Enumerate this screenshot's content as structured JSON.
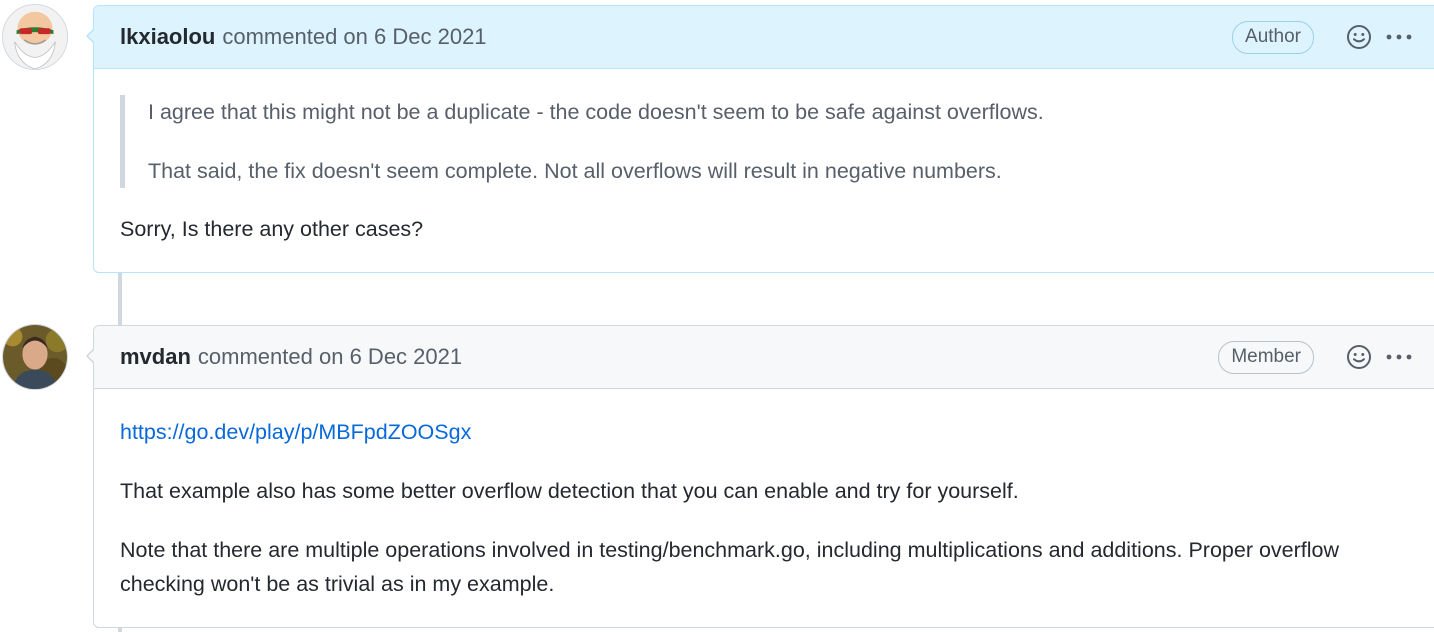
{
  "comments": [
    {
      "author": "lkxiaolou",
      "meta": "commented on",
      "date": "6 Dec 2021",
      "badge": "Author",
      "avatar_icon": "avatar-cartoon-icon",
      "quote": [
        "I agree that this might not be a duplicate - the code doesn't seem to be safe against overflows.",
        "That said, the fix doesn't seem complete. Not all overflows will result in negative numbers."
      ],
      "body": "Sorry, Is there any other cases?"
    },
    {
      "author": "mvdan",
      "meta": "commented on",
      "date": "6 Dec 2021",
      "badge": "Member",
      "avatar_icon": "avatar-photo-icon",
      "link": "https://go.dev/play/p/MBFpdZOOSgx",
      "paragraphs": [
        "That example also has some better overflow detection that you can enable and try for yourself.",
        "Note that there are multiple operations involved in testing/benchmark.go, including multiplications and additions. Proper overflow checking won't be as trivial as in my example."
      ]
    }
  ],
  "icons": {
    "reaction": "smiley-icon",
    "menu": "kebab-horizontal-icon"
  },
  "colors": {
    "author_header_bg": "#ddf4ff",
    "author_border": "#b6e3ff",
    "member_header_bg": "#f6f8fa",
    "link": "#0969da",
    "muted": "#57606a"
  }
}
